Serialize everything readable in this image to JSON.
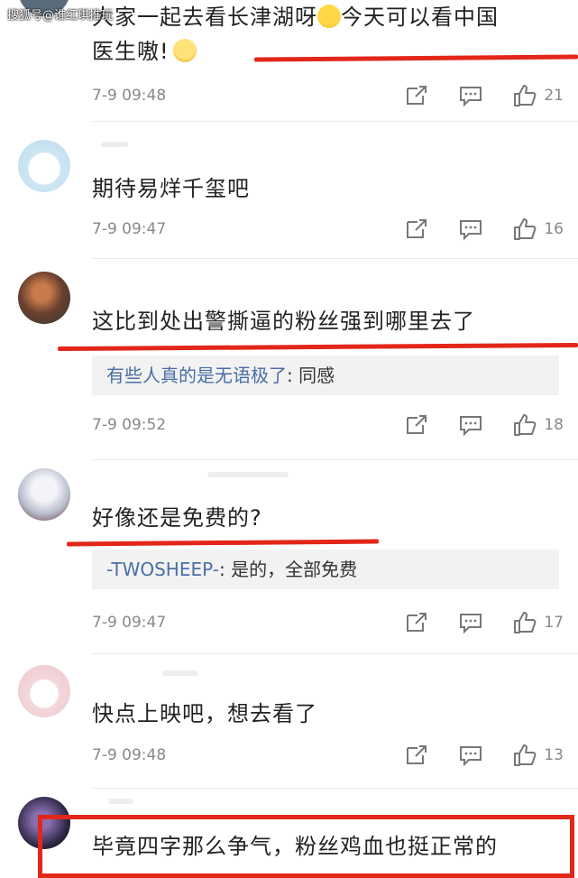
{
  "watermark": "搜狐号@谁红琪推玩",
  "comments": [
    {
      "text_line1": "大家一起去看长津湖呀",
      "text_line1b": "今天可以看中国",
      "text_line2": "医生嗷!",
      "time": "7-9 09:48",
      "likes": "21"
    },
    {
      "text": "期待易烊千玺吧",
      "time": "7-9 09:47",
      "likes": "16"
    },
    {
      "text": "这比到处出警撕逼的粉丝强到哪里去了",
      "reply_user": "有些人真的是无语极了",
      "reply_text": ": 同感",
      "time": "7-9 09:52",
      "likes": "18"
    },
    {
      "text": "好像还是免费的?",
      "reply_user": "-TWOSHEEP-",
      "reply_text": ": 是的，全部免费",
      "time": "7-9 09:47",
      "likes": "17"
    },
    {
      "text": "快点上映吧，想去看了",
      "time": "7-9 09:48",
      "likes": "13"
    },
    {
      "text": "毕竟四字那么争气，粉丝鸡血也挺正常的"
    }
  ],
  "icons": {
    "repost": "repost-icon",
    "comment": "comment-icon",
    "like": "like-icon"
  },
  "colors": {
    "highlight": "#e3261a",
    "reply_user": "#4a6fa5",
    "meta_text": "#888888"
  }
}
